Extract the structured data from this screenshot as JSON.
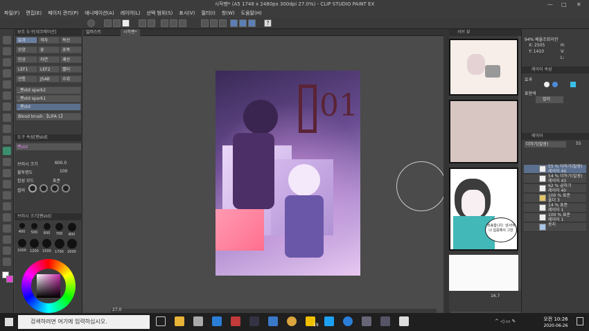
{
  "window": {
    "title": "시작펜* (A5 1748 x 2480px 300dpi 27.0%) - CLIP STUDIO PAINT EX"
  },
  "menu": [
    "파일(F)",
    "편집(E)",
    "페이지 관리(P)",
    "애니메이션(A)",
    "레이어(L)",
    "선택 범위(S)",
    "표시(V)",
    "필터(I)",
    "창(W)",
    "도움말(H)"
  ],
  "doc_tabs": [
    "일러스트",
    "시작펜*"
  ],
  "sub_tool": {
    "header": "보조 도구[데코레이션]",
    "items": [
      "효과",
      "격자",
      "복선",
      "모양",
      "꽃",
      "초목",
      "인공",
      "자연",
      "괘선",
      "LEF1",
      "LEF2",
      "펠터",
      "관통",
      "JSAB",
      "수위"
    ],
    "brushes": [
      "_펜std spark2",
      "_펜std spark1",
      "_펜std",
      "Blood brush 【LIFA 1】"
    ]
  },
  "tool_property": {
    "header": "도구 속성[펜std]",
    "size_label": "브러시 크기",
    "size_value": "600.0",
    "opacity_label": "불투명도",
    "opacity_value": "100",
    "blend_label": "합성 모드",
    "blend_value": "표준",
    "color_label": "컬러"
  },
  "brush_size": {
    "header": "브러시 크기[펜std]",
    "sizes": [
      "400",
      "500",
      "600",
      "700",
      "800",
      "1000",
      "1200",
      "1500",
      "1700",
      "2000"
    ]
  },
  "canvas": {
    "zoom": "27.0"
  },
  "nav": {
    "header": "서브 뷰"
  },
  "info": {
    "zoom_text": "94% 배율조회이전",
    "x": "X: 2505",
    "y": "Y: 1410",
    "h": "H:",
    "v": "V:",
    "l": "L:"
  },
  "layer_property": {
    "header": "레이어 속성",
    "effect_label": "효과",
    "color_label": "표현색",
    "color_value": "컬러"
  },
  "layers": {
    "header": "레이어",
    "blend": "더하기(발광)",
    "opacity": "55",
    "items": [
      {
        "line1": "55 % 더하기(발광)",
        "line2": "레이어 44",
        "selected": true
      },
      {
        "line1": "54 % 더하기(발광)",
        "line2": "레이어 43",
        "selected": false
      },
      {
        "line1": "62 % 곱하기",
        "line2": "레이어 40",
        "selected": false
      },
      {
        "line1": "100 % 표준",
        "line2": "폴더 3",
        "selected": false
      },
      {
        "line1": "14 % 표준",
        "line2": "레이어 1",
        "selected": false
      },
      {
        "line1": "100 % 표준",
        "line2": "레이어 1",
        "selected": false
      },
      {
        "line1": "",
        "line2": "용지",
        "selected": false
      }
    ]
  },
  "comic": {
    "speech": "죄송합니다. 넘사에 너 집중해서 그만"
  },
  "panel_bottom": {
    "value": "16.7"
  },
  "art": {
    "numeral": "01"
  },
  "taskbar": {
    "search_placeholder": "검색하려면 여기에 입력하십시오.",
    "time": "오전 10:26",
    "date": "2020-06-26",
    "badge": "19"
  }
}
